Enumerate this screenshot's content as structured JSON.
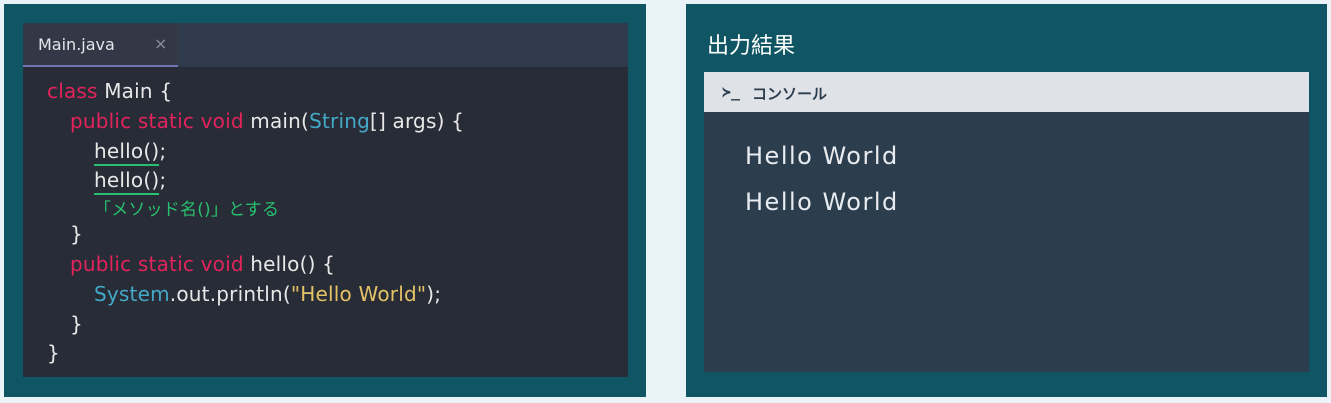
{
  "editor": {
    "tab_label": "Main.java",
    "tab_close": "×",
    "lines": [
      {
        "segments": [
          [
            "class",
            "kw"
          ],
          [
            " Main {",
            ""
          ]
        ]
      },
      {
        "segments": [
          [
            "public static void",
            "kw"
          ],
          [
            " main(",
            ""
          ],
          [
            "String",
            "ty"
          ],
          [
            "[] args) {",
            ""
          ]
        ]
      },
      {
        "segments": [
          [
            "hello()",
            "ul"
          ],
          [
            ";",
            ""
          ]
        ]
      },
      {
        "segments": [
          [
            "hello()",
            "ul"
          ],
          [
            ";",
            ""
          ]
        ]
      },
      {
        "segments": [
          [
            "「メソッド名()」とする",
            "cm"
          ]
        ]
      },
      {
        "segments": [
          [
            "}",
            ""
          ]
        ]
      },
      {
        "segments": [
          [
            "public static void",
            "kw"
          ],
          [
            " hello() {",
            ""
          ]
        ]
      },
      {
        "segments": [
          [
            "System",
            "ty"
          ],
          [
            ".out.println(",
            ""
          ],
          [
            "\"Hello World\"",
            "str"
          ],
          [
            ");",
            ""
          ]
        ]
      },
      {
        "segments": [
          [
            "}",
            ""
          ]
        ]
      },
      {
        "segments": [
          [
            "}",
            ""
          ]
        ]
      }
    ]
  },
  "output": {
    "title": "出力結果",
    "console_icon": "≻_",
    "console_label": "コンソール",
    "lines": [
      "Hello World",
      "Hello World"
    ]
  },
  "colors": {
    "frame": "#0f5563",
    "keyword": "#e2235c",
    "type": "#44a8c8",
    "string": "#e4c266",
    "comment": "#28c070"
  }
}
